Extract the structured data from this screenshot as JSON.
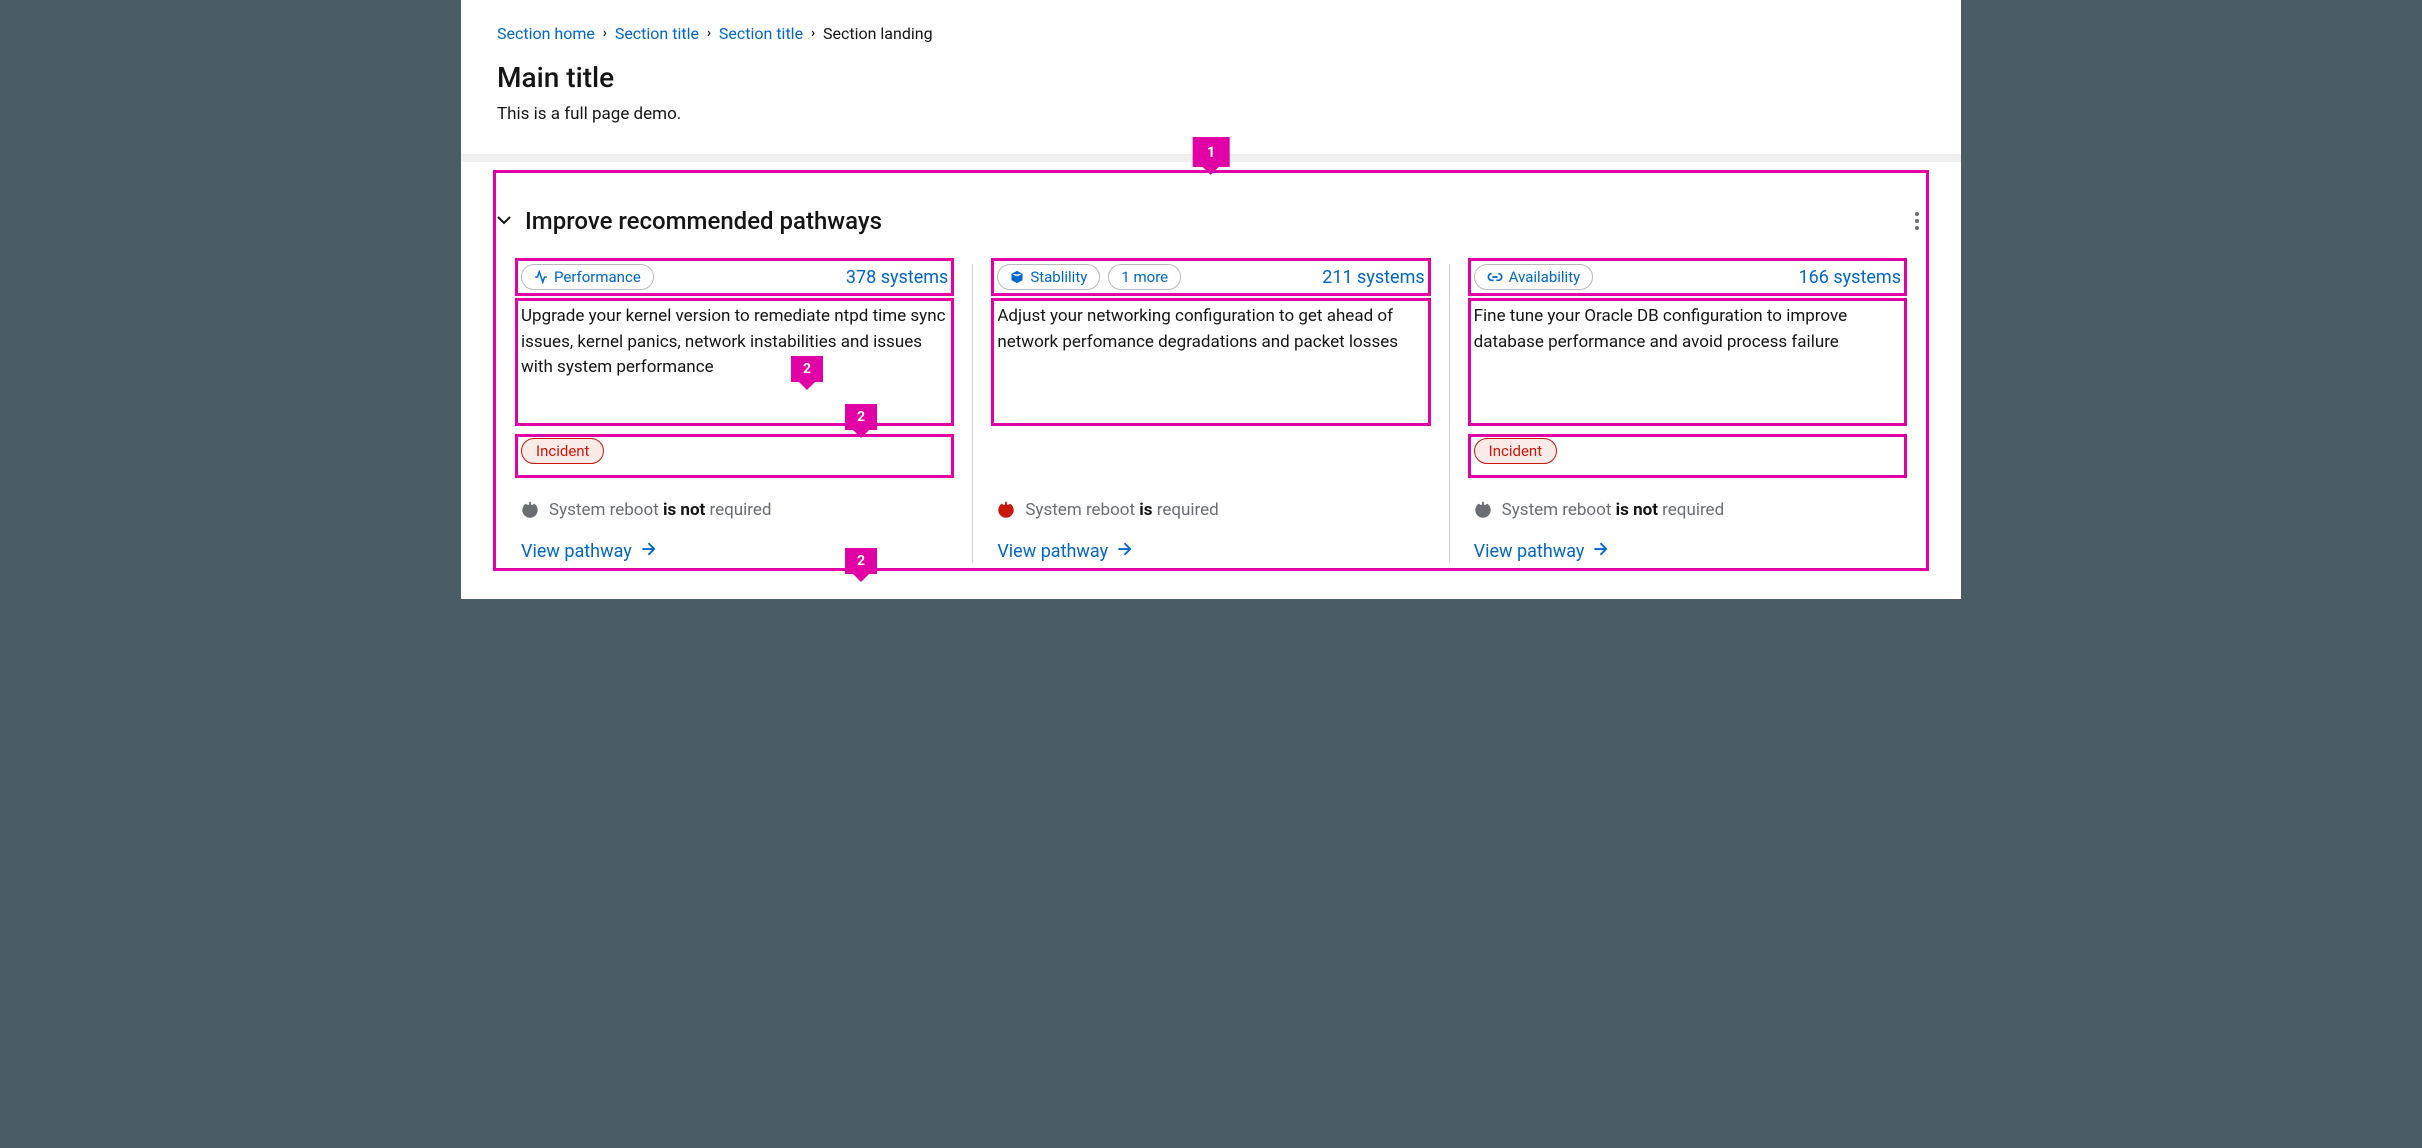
{
  "breadcrumb": {
    "home": "Section home",
    "level1": "Section title",
    "level2": "Section title",
    "current": "Section landing"
  },
  "header": {
    "title": "Main title",
    "subtitle": "This is a full page demo."
  },
  "section": {
    "title": "Improve recommended pathways"
  },
  "callouts": {
    "c1": "1",
    "c2a": "2",
    "c2b": "2",
    "c2c": "2"
  },
  "cards": [
    {
      "tag": "Performance",
      "tag_icon": "activity-icon",
      "more": null,
      "systems": "378 systems",
      "description": "Upgrade your kernel version to remediate ntpd time sync issues, kernel panics, network instabilities and issues with system performance",
      "incident": "Incident",
      "reboot_prefix": "System reboot ",
      "reboot_emph": "is not",
      "reboot_suffix": " required",
      "reboot_kind": "gray",
      "link": "View pathway"
    },
    {
      "tag": "Stablility",
      "tag_icon": "cube-icon",
      "more": "1 more",
      "systems": "211 systems",
      "description": "Adjust your networking configuration to get ahead of network perfomance degradations and packet losses",
      "incident": null,
      "reboot_prefix": "System reboot ",
      "reboot_emph": "is",
      "reboot_suffix": " required",
      "reboot_kind": "red",
      "link": "View pathway"
    },
    {
      "tag": "Availability",
      "tag_icon": "link-icon",
      "more": null,
      "systems": "166 systems",
      "description": "Fine tune your Oracle DB configuration to improve database performance and avoid process failure",
      "incident": "Incident",
      "reboot_prefix": "System reboot ",
      "reboot_emph": "is not",
      "reboot_suffix": " required",
      "reboot_kind": "gray",
      "link": "View pathway"
    }
  ]
}
